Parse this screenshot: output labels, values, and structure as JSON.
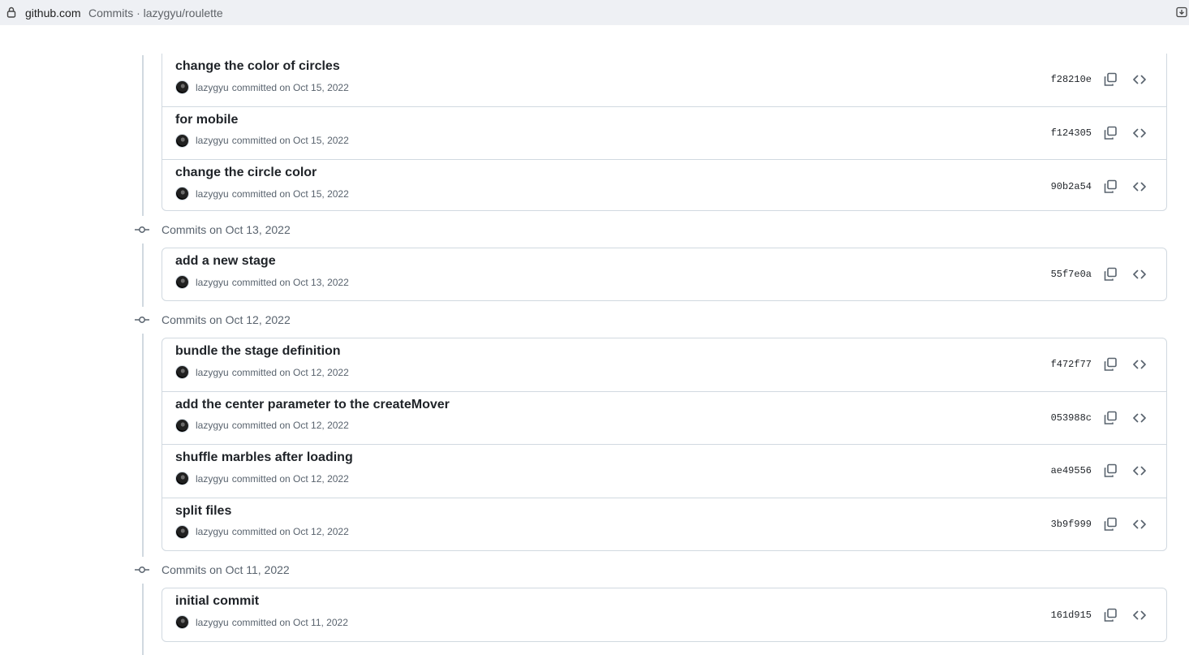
{
  "browser": {
    "domain": "github.com",
    "page_title": "Commits · lazygyu/roulette"
  },
  "top_group": {
    "commits": [
      {
        "title": "change the color of circles",
        "author": "lazygyu",
        "meta": "committed on Oct 15, 2022",
        "sha": "f28210e"
      },
      {
        "title": "for mobile",
        "author": "lazygyu",
        "meta": "committed on Oct 15, 2022",
        "sha": "f124305"
      },
      {
        "title": "change the circle color",
        "author": "lazygyu",
        "meta": "committed on Oct 15, 2022",
        "sha": "90b2a54"
      }
    ]
  },
  "groups": [
    {
      "title": "Commits on Oct 13, 2022",
      "commits": [
        {
          "title": "add a new stage",
          "author": "lazygyu",
          "meta": "committed on Oct 13, 2022",
          "sha": "55f7e0a"
        }
      ]
    },
    {
      "title": "Commits on Oct 12, 2022",
      "commits": [
        {
          "title": "bundle the stage definition",
          "author": "lazygyu",
          "meta": "committed on Oct 12, 2022",
          "sha": "f472f77"
        },
        {
          "title": "add the center parameter to the createMover",
          "author": "lazygyu",
          "meta": "committed on Oct 12, 2022",
          "sha": "053988c"
        },
        {
          "title": "shuffle marbles after loading",
          "author": "lazygyu",
          "meta": "committed on Oct 12, 2022",
          "sha": "ae49556"
        },
        {
          "title": "split files",
          "author": "lazygyu",
          "meta": "committed on Oct 12, 2022",
          "sha": "3b9f999"
        }
      ]
    },
    {
      "title": "Commits on Oct 11, 2022",
      "commits": [
        {
          "title": "initial commit",
          "author": "lazygyu",
          "meta": "committed on Oct 11, 2022",
          "sha": "161d915"
        }
      ]
    }
  ],
  "icons": {
    "lock": "lock-icon",
    "install": "install-icon",
    "commit_node": "git-commit-icon",
    "copy": "copy-icon",
    "browse": "code-icon"
  },
  "colors": {
    "border": "#d1d9e0",
    "muted_text": "#59636e",
    "text": "#1f2328",
    "addressbar_bg": "#eef0f4"
  }
}
